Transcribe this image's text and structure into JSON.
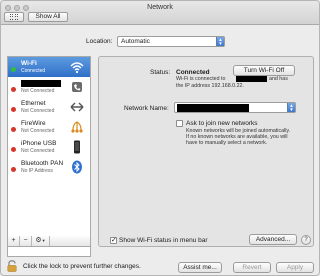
{
  "window": {
    "title": "Network"
  },
  "toolbar": {
    "show_all_label": "Show All"
  },
  "location": {
    "label": "Location:",
    "value": "Automatic"
  },
  "services": [
    {
      "name": "Wi-Fi",
      "status": "Connected",
      "status_color": "#2fbf3a",
      "icon": "wifi-icon"
    },
    {
      "name": "",
      "status": "Not Connected",
      "status_color": "#d9362b",
      "icon": "phone-icon"
    },
    {
      "name": "Ethernet",
      "status": "Not Connected",
      "status_color": "#d9362b",
      "icon": "ethernet-icon"
    },
    {
      "name": "FireWire",
      "status": "Not Connected",
      "status_color": "#d9362b",
      "icon": "firewire-icon"
    },
    {
      "name": "iPhone USB",
      "status": "Not Connected",
      "status_color": "#d9362b",
      "icon": "iphone-icon"
    },
    {
      "name": "Bluetooth PAN",
      "status": "No IP Address",
      "status_color": "#d9362b",
      "icon": "bluetooth-icon"
    }
  ],
  "sidebar_tools": {
    "add": "+",
    "remove": "−",
    "gear": "⚙"
  },
  "detail": {
    "status_label": "Status:",
    "status_value": "Connected",
    "turn_off_label": "Turn Wi-Fi Off",
    "status_desc_1": "Wi-Fi is connected to",
    "status_desc_2": "and has",
    "status_desc_3": "the IP address 192.168.0.22.",
    "network_name_label": "Network Name:",
    "network_name_value": "",
    "ask_join_label": "Ask to join new networks",
    "ask_join_desc_1": "Known networks will be joined automatically.",
    "ask_join_desc_2": "If no known networks are available, you will",
    "ask_join_desc_3": "have to manually select a network.",
    "show_status_label": "Show Wi-Fi status in menu bar",
    "advanced_label": "Advanced...",
    "help_label": "?"
  },
  "footer": {
    "lock_text": "Click the lock to prevent further changes.",
    "assist_label": "Assist me...",
    "revert_label": "Revert",
    "apply_label": "Apply"
  },
  "colors": {
    "selection": "#3d7fd6",
    "connected": "#2fbf3a",
    "not_connected": "#d9362b"
  }
}
